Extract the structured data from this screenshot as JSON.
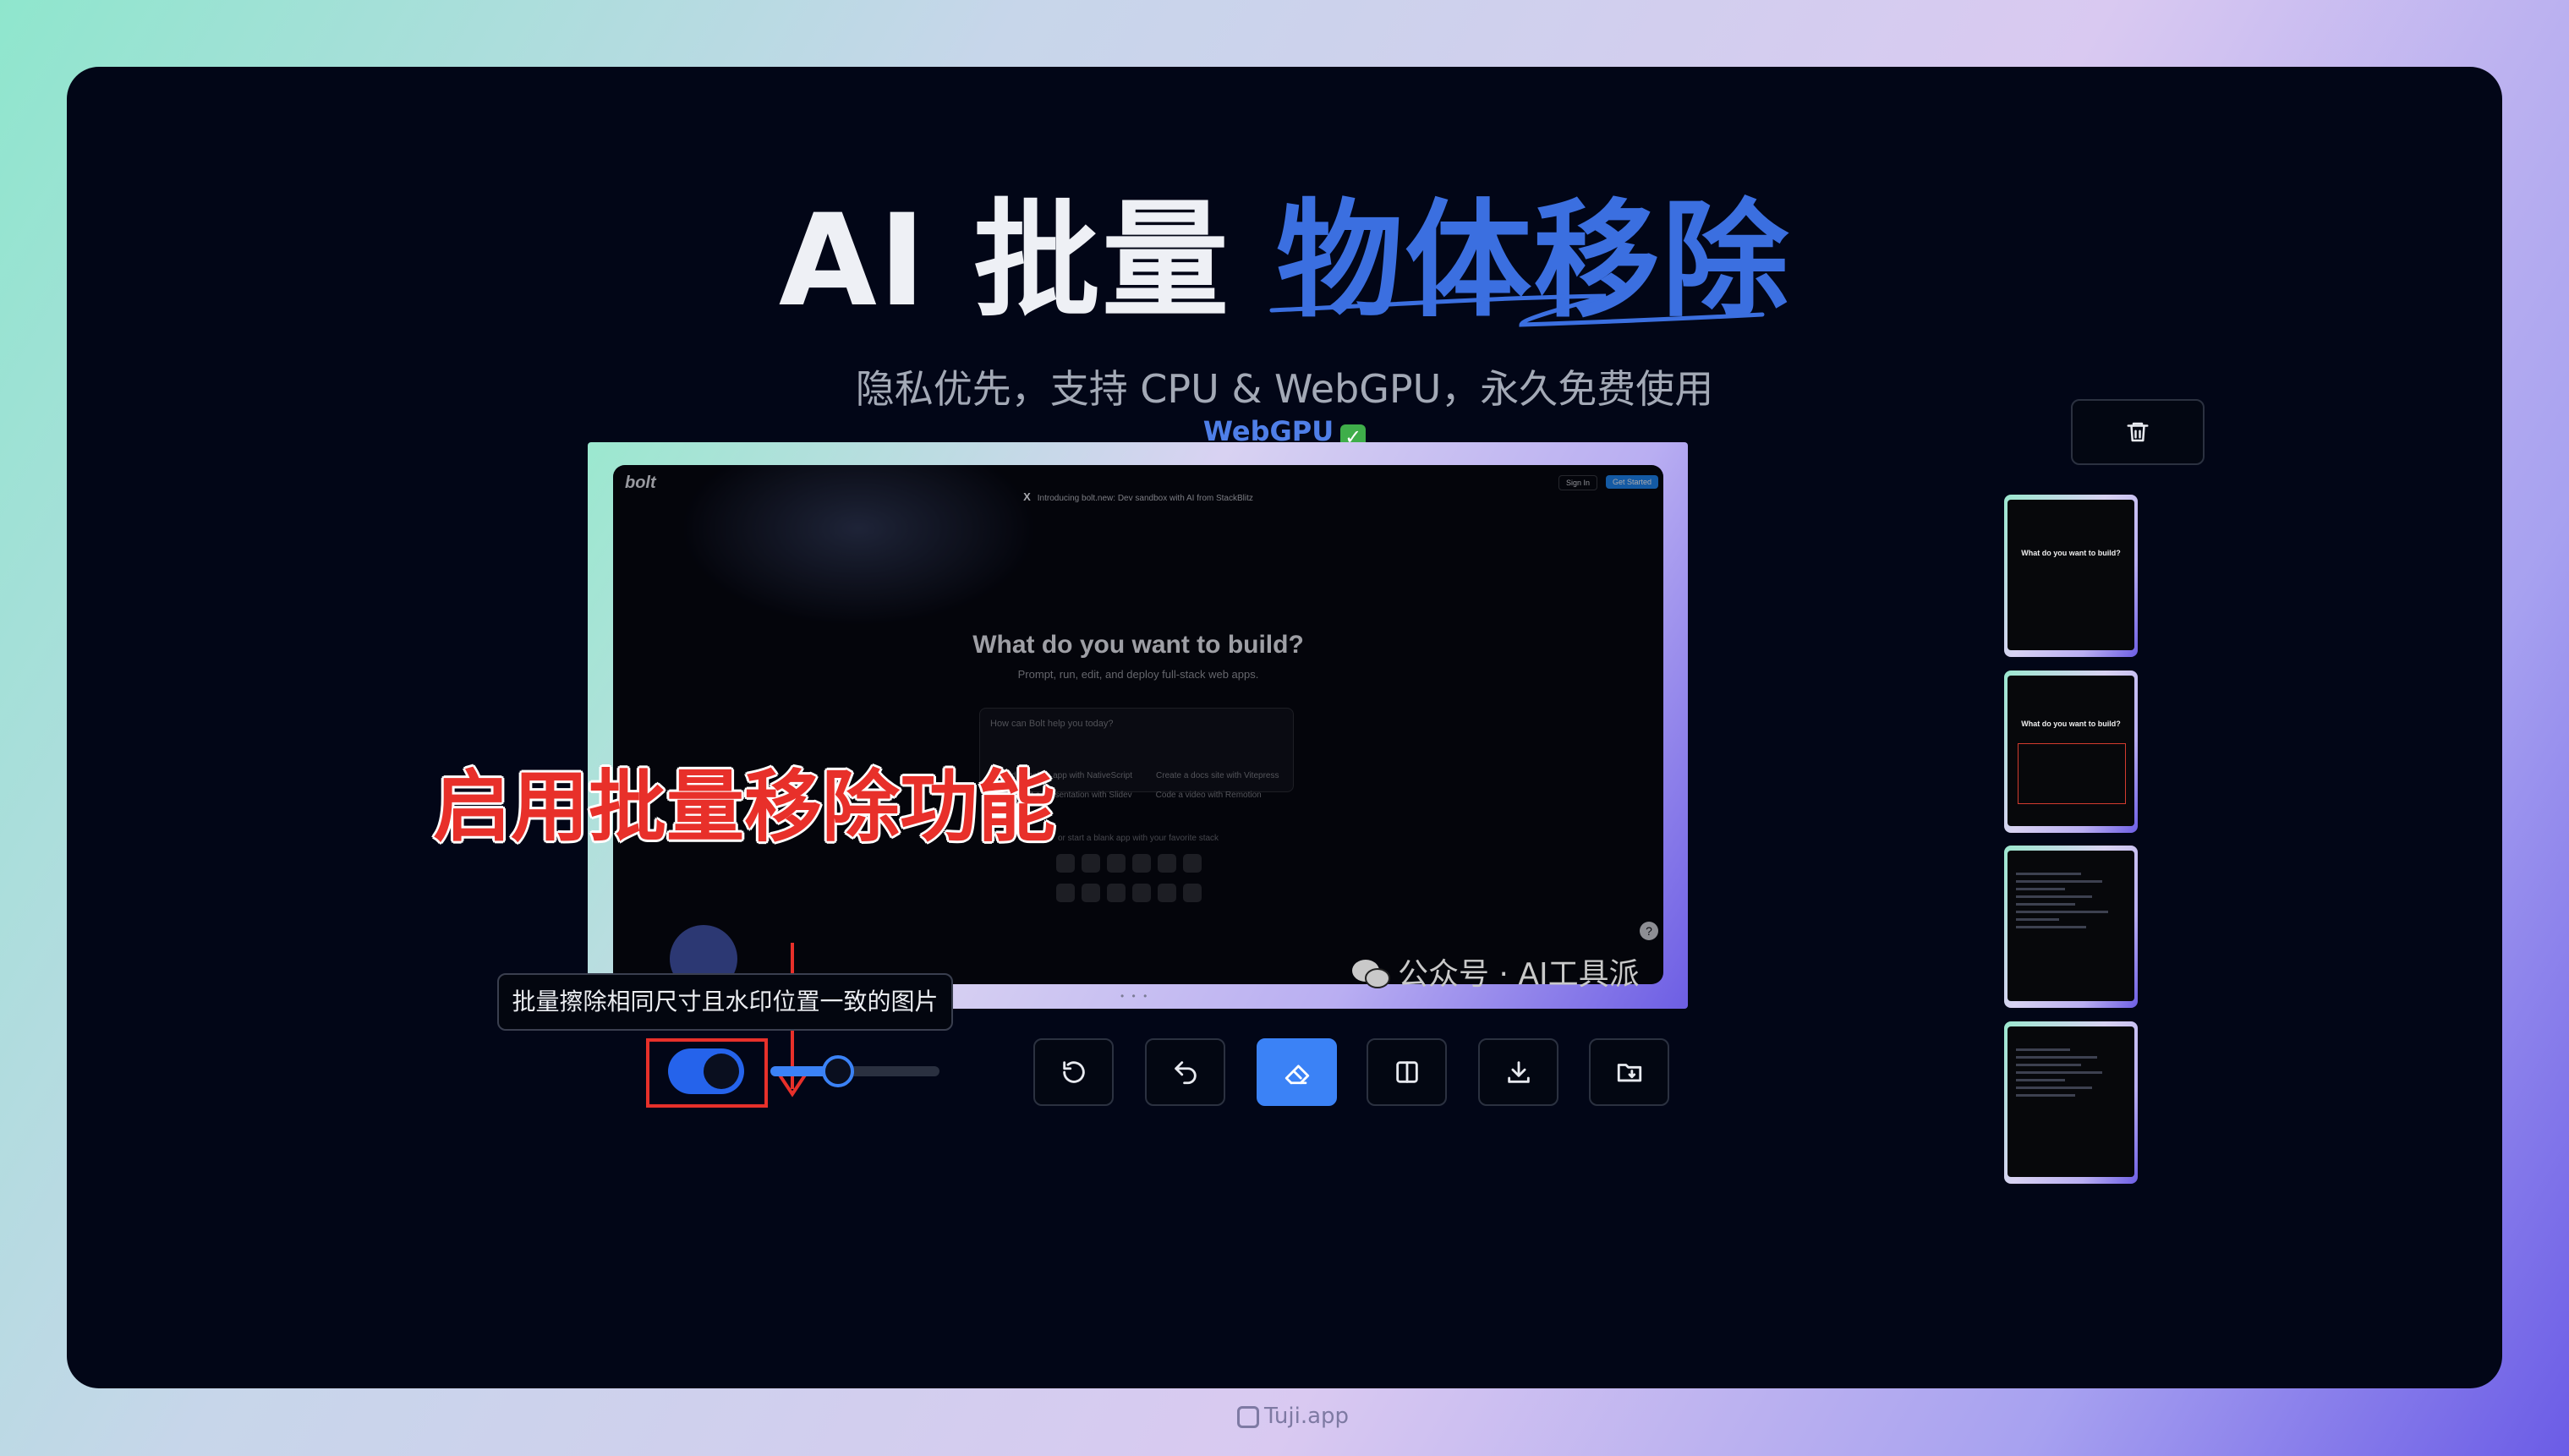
{
  "title": {
    "part1": "AI 批量",
    "accent": "物体移除"
  },
  "subtitle": "隐私优先，支持 CPU & WebGPU，永久免费使用",
  "webgpu": {
    "label": "WebGPU",
    "check": "✓"
  },
  "preview": {
    "brand": "bolt",
    "announcement": "Introducing bolt.new: Dev sandbox with AI from StackBlitz",
    "x_glyph": "X",
    "sign_in": "Sign In",
    "get_started": "Get Started",
    "headline": "What do you want to build?",
    "subline": "Prompt, run, edit, and deploy full-stack web apps.",
    "prompt_placeholder": "How can Bolt help you today?",
    "suggestions": [
      "Build a mobile app with NativeScript",
      "Create a docs site with Vitepress",
      "Draft a presentation with Slidev",
      "Code a video with Remotion"
    ],
    "blank_app": "or start a blank app with your favorite stack",
    "watermark": "公众号 · AI工具派",
    "help": "?",
    "dots": "• • •"
  },
  "annotation": "启用批量移除功能",
  "tooltip": "批量擦除相同尺寸且水印位置一致的图片",
  "toolbar": {
    "batch_toggle_on": true,
    "brush_size_fraction": 0.38,
    "buttons": [
      "reset-icon",
      "undo-icon",
      "eraser-icon",
      "compare-icon",
      "download-icon",
      "save-folder-icon"
    ],
    "active": "eraser-icon"
  },
  "sidebar": {
    "delete_icon": "trash-icon",
    "thumbnails": [
      {
        "caption": "What do you want to build?"
      },
      {
        "caption": "What do you want to build?"
      },
      {
        "caption": ""
      },
      {
        "caption": ""
      }
    ]
  },
  "footer": "Tuji.app",
  "colors": {
    "accent": "#3b6fe0",
    "panel": "#020617",
    "highlight": "#e8302a",
    "primary": "#3b82f6"
  }
}
